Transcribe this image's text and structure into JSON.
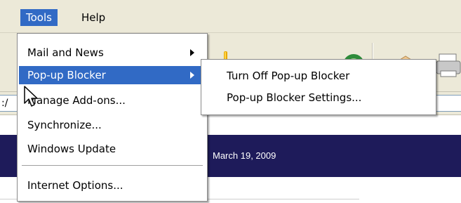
{
  "menubar": {
    "items": [
      {
        "label": "Tools",
        "active": true
      },
      {
        "label": "Help",
        "active": false
      }
    ]
  },
  "address": {
    "fragment": ":/"
  },
  "page": {
    "date": "March 19, 2009"
  },
  "tools_menu": {
    "items": [
      {
        "label": "Mail and News",
        "submenu": true
      },
      {
        "label": "Pop-up Blocker",
        "submenu": true,
        "highlighted": true
      },
      {
        "label": "Manage Add-ons..."
      },
      {
        "label": "Synchronize..."
      },
      {
        "label": "Windows Update"
      },
      {
        "label": "Internet Options..."
      }
    ]
  },
  "popup_submenu": {
    "items": [
      {
        "label": "Turn Off Pop-up Blocker"
      },
      {
        "label": "Pop-up Blocker Settings..."
      }
    ]
  },
  "icons": [
    "warning-icon",
    "refresh-icon",
    "folder-icon",
    "print-icon",
    "mouse-pointer-icon"
  ],
  "colors": {
    "highlight": "#316ac5",
    "banner": "#1e1b5a",
    "chrome": "#ece9d8"
  }
}
